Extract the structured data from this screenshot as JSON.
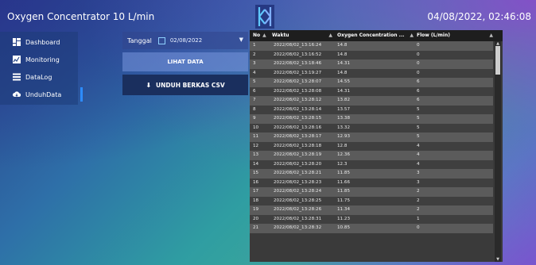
{
  "header": {
    "title": "Oxygen Concentrator 10 L/min",
    "datetime": "04/08/2022, 02:46:08"
  },
  "sidebar": {
    "items": [
      {
        "label": "Dashboard",
        "icon": "dashboard-icon"
      },
      {
        "label": "Monitoring",
        "icon": "monitoring-icon"
      },
      {
        "label": "DataLog",
        "icon": "list-icon"
      },
      {
        "label": "UnduhData",
        "icon": "cloud-download-icon"
      }
    ],
    "active_index": 3
  },
  "panel": {
    "date_label": "Tanggal",
    "date_value": "02/08/2022",
    "view_button": "LIHAT DATA",
    "csv_button": "UNDUH BERKAS CSV"
  },
  "table": {
    "headers": [
      "No",
      "Waktu",
      "Oxygen Concentration ...",
      "Flow (L/min)"
    ],
    "rows": [
      [
        "1",
        "2022/08/02_13:16:24",
        "14.8",
        "0"
      ],
      [
        "2",
        "2022/08/02_13:16:52",
        "14.8",
        "0"
      ],
      [
        "3",
        "2022/08/02_13:18:46",
        "14.31",
        "0"
      ],
      [
        "4",
        "2022/08/02_13:19:27",
        "14.8",
        "0"
      ],
      [
        "5",
        "2022/08/02_13:28:07",
        "14.55",
        "6"
      ],
      [
        "6",
        "2022/08/02_13:28:08",
        "14.31",
        "6"
      ],
      [
        "7",
        "2022/08/02_13:28:12",
        "13.82",
        "6"
      ],
      [
        "8",
        "2022/08/02_13:28:14",
        "13.57",
        "5"
      ],
      [
        "9",
        "2022/08/02_13:28:15",
        "13.38",
        "5"
      ],
      [
        "10",
        "2022/08/02_13:28:16",
        "13.32",
        "5"
      ],
      [
        "11",
        "2022/08/02_13:28:17",
        "12.93",
        "5"
      ],
      [
        "12",
        "2022/08/02_13:28:18",
        "12.8",
        "4"
      ],
      [
        "13",
        "2022/08/02_13:28:19",
        "12.36",
        "4"
      ],
      [
        "14",
        "2022/08/02_13:28:20",
        "12.3",
        "4"
      ],
      [
        "15",
        "2022/08/02_13:28:21",
        "11.85",
        "3"
      ],
      [
        "16",
        "2022/08/02_13:28:23",
        "11.66",
        "3"
      ],
      [
        "17",
        "2022/08/02_13:28:24",
        "11.85",
        "2"
      ],
      [
        "18",
        "2022/08/02_13:28:25",
        "11.75",
        "2"
      ],
      [
        "19",
        "2022/08/02_13:28:26",
        "11.34",
        "2"
      ],
      [
        "20",
        "2022/08/02_13:28:31",
        "11.23",
        "1"
      ],
      [
        "21",
        "2022/08/02_13:28:32",
        "10.85",
        "0"
      ]
    ]
  },
  "colors": {
    "accent": "#2d8cff",
    "table_bg": "#3a3a3a",
    "header_bg": "#1e1e1e"
  }
}
